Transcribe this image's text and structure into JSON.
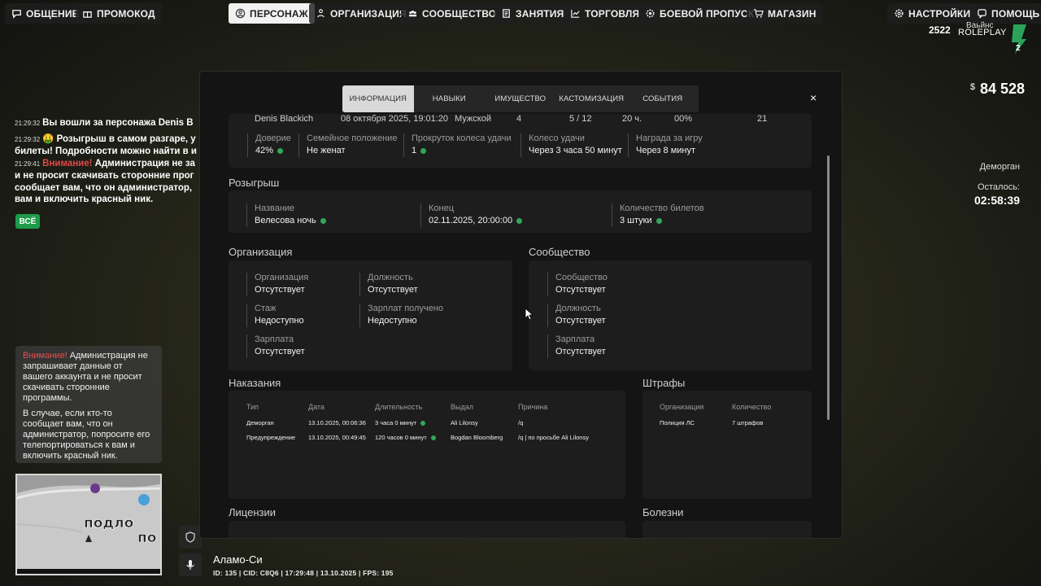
{
  "topbar": {
    "left": [
      {
        "label": "ОБЩЕНИЕ",
        "icon": "chat-bubble-icon"
      },
      {
        "label": "ПРОМОКОД",
        "icon": "gift-icon"
      }
    ],
    "center": [
      {
        "label": "ПЕРСОНАЖ",
        "icon": "user-circle-icon",
        "active": true
      },
      {
        "label": "ОРГАНИЗАЦИЯ",
        "icon": "people-icon"
      },
      {
        "label": "СООБЩЕСТВО",
        "icon": "group-icon"
      },
      {
        "label": "ЗАНЯТИЯ",
        "icon": "book-icon"
      },
      {
        "label": "ТОРГОВЛЯ",
        "icon": "chart-line-icon"
      },
      {
        "label": "БОЕВОЙ ПРОПУСК",
        "icon": "gear-badge-icon"
      },
      {
        "label": "МАГАЗИН",
        "icon": "cart-icon"
      }
    ],
    "right": [
      {
        "label": "НАСТРОЙКИ",
        "icon": "gear-icon"
      },
      {
        "label": "ПОМОЩЬ",
        "icon": "help-bubble-icon"
      }
    ]
  },
  "logo": {
    "number": "2522",
    "line1": "Ваьйнс",
    "line2": "ROLEPLAY",
    "badge_digit": "2"
  },
  "money": {
    "currency": "$",
    "value": "84 528"
  },
  "status": {
    "label": "Деморган",
    "remaining_label": "Осталось:",
    "remaining_value": "02:58:39"
  },
  "chat": {
    "lines": [
      {
        "time": "21:29:32",
        "text": "Вы вошли за персонажа Denis B"
      },
      {
        "time": "21:29:32",
        "emoji": "🤑",
        "text": "Розыгрыш в самом разгаре, у",
        "cont": "билеты! Подробности можно найти в и"
      },
      {
        "time": "21:29:41",
        "warn": "Внимание!",
        "text": "Администрация не за",
        "cont": "и не просит скачивать сторонние прог",
        "cont2": "сообщает вам, что он администратор,",
        "cont3": "вам и включить красный ник."
      }
    ],
    "all_button": "ВСЁ"
  },
  "notice": {
    "warn": "Внимание!",
    "p1": "Администрация не запрашивает данные от вашего аккаунта и не просит скачивать сторонние программы.",
    "p2": "В случае, если кто-то сообщает вам, что он администратор, попросите его телепортироваться к вам и включить красный ник."
  },
  "minimap": {
    "label": "подло",
    "label2": "по"
  },
  "location": {
    "name": "Аламо-Си",
    "ids": "ID: 135 | CID: C8Q6 | 17:29:48 | 13.10.2025 | FPS: 195"
  },
  "modal": {
    "tabs": [
      "ИНФОРМАЦИЯ",
      "НАВЫКИ",
      "ИМУЩЕСТВО",
      "КАСТОМИЗАЦИЯ",
      "СОБЫТИЯ"
    ],
    "close": "×",
    "top_cut": [
      "Denis Blackich",
      "08 октября 2025, 19:01:20",
      "Мужской",
      "4",
      "5 / 12",
      "20 ч.",
      "00%",
      "21"
    ],
    "info_row": [
      {
        "label": "Доверие",
        "value": "42%",
        "dot": true
      },
      {
        "label": "Семейное положение",
        "value": "Не женат",
        "dot": false
      },
      {
        "label": "Прокруток колеса удачи",
        "value": "1",
        "dot": true
      },
      {
        "label": "Колесо удачи",
        "value": "Через 3 часа 50 минут",
        "dot": false
      },
      {
        "label": "Награда за игру",
        "value": "Через 8 минут",
        "dot": false
      }
    ],
    "raffle": {
      "title": "Розыгрыш",
      "fields": [
        {
          "label": "Название",
          "value": "Велесова ночь"
        },
        {
          "label": "Конец",
          "value": "02.11.2025, 20:00:00"
        },
        {
          "label": "Количество билетов",
          "value": "3 штуки"
        }
      ]
    },
    "organization": {
      "title": "Организация",
      "fields": [
        {
          "label": "Организация",
          "value": "Отсутствует"
        },
        {
          "label": "Должность",
          "value": "Отсутствует"
        },
        {
          "label": "Стаж",
          "value": "Недоступно"
        },
        {
          "label": "Зарплат получено",
          "value": "Недоступно"
        },
        {
          "label": "Зарплата",
          "value": "Отсутствует"
        }
      ]
    },
    "community": {
      "title": "Сообщество",
      "fields": [
        {
          "label": "Сообщество",
          "value": "Отсутствует"
        },
        {
          "label": "Должность",
          "value": "Отсутствует"
        },
        {
          "label": "Зарплата",
          "value": "Отсутствует"
        }
      ]
    },
    "punishments": {
      "title": "Наказания",
      "headers": [
        "Тип",
        "Дата",
        "Длительность",
        "Выдал",
        "Причина"
      ],
      "rows": [
        [
          "Деморган",
          "13.10.2025, 00:06:36",
          "3 часа 0 минут",
          "Ali Lilonsy",
          "/q"
        ],
        [
          "Предупреждение",
          "13.10.2025, 00:49:45",
          "120 часов 0 минут",
          "Bogdan Bloomberg",
          "/q | по просьбе Ali Lilonsy"
        ]
      ]
    },
    "fines": {
      "title": "Штрафы",
      "headers": [
        "Организация",
        "Количество"
      ],
      "rows": [
        [
          "Полиция ЛС",
          "7 штрафов"
        ]
      ]
    },
    "licenses": {
      "title": "Лицензии"
    },
    "diseases": {
      "title": "Болезни"
    }
  }
}
